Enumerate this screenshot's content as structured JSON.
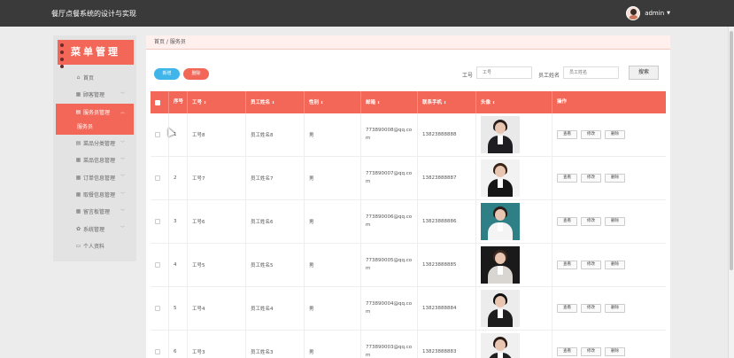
{
  "app": {
    "title": "餐厅点餐系统的设计与实现",
    "user": "admin"
  },
  "sidebar": {
    "logo": "菜单管理",
    "items": [
      {
        "label": "首页",
        "icon": "home-icon",
        "glyph": "⌂",
        "expandable": false
      },
      {
        "label": "顾客管理",
        "icon": "grid-icon",
        "glyph": "▦",
        "expandable": true
      },
      {
        "label": "服务员管理",
        "icon": "briefcase-icon",
        "glyph": "▤",
        "expandable": true,
        "active": true,
        "sub": "服务员"
      },
      {
        "label": "菜品分类管理",
        "icon": "briefcase-icon",
        "glyph": "▤",
        "expandable": true
      },
      {
        "label": "菜品信息管理",
        "icon": "grid-icon",
        "glyph": "▦",
        "expandable": true
      },
      {
        "label": "订单信息管理",
        "icon": "grid-icon",
        "glyph": "▦",
        "expandable": true
      },
      {
        "label": "取餐信息管理",
        "icon": "grid-icon",
        "glyph": "▦",
        "expandable": true
      },
      {
        "label": "留言板管理",
        "icon": "grid-icon",
        "glyph": "▦",
        "expandable": true
      },
      {
        "label": "系统管理",
        "icon": "gear-icon",
        "glyph": "✿",
        "expandable": true
      },
      {
        "label": "个人资料",
        "icon": "calendar-icon",
        "glyph": "▭",
        "expandable": false
      }
    ]
  },
  "main": {
    "breadcrumb": "首页 / 服务员",
    "add_label": "新增",
    "delete_label": "删除",
    "search": {
      "job_label": "工号",
      "job_placeholder": "工号",
      "name_label": "员工姓名",
      "name_placeholder": "员工姓名",
      "button_label": "搜索"
    },
    "table": {
      "headers": [
        "序号",
        "工号",
        "员工姓名",
        "性别",
        "邮箱",
        "联系手机",
        "头像",
        "操作"
      ],
      "rows": [
        {
          "no": "1",
          "job": "工号8",
          "name": "员工姓名8",
          "gender": "男",
          "email": "773890008@qq.com",
          "phone": "13823888888",
          "photo": {
            "bg": "#e9e9e9",
            "hair": "#2a1f1c",
            "body": "#1e1e22"
          }
        },
        {
          "no": "2",
          "job": "工号7",
          "name": "员工姓名7",
          "gender": "男",
          "email": "773890007@qq.com",
          "phone": "13823888887",
          "photo": {
            "bg": "#f2f2f2",
            "hair": "#3a2418",
            "body": "#161616"
          }
        },
        {
          "no": "3",
          "job": "工号6",
          "name": "员工姓名6",
          "gender": "男",
          "email": "773890006@qq.com",
          "phone": "13823888886",
          "photo": {
            "bg": "#2f7f86",
            "hair": "#2b1c18",
            "body": "#f4f4f4"
          }
        },
        {
          "no": "4",
          "job": "工号5",
          "name": "员工姓名5",
          "gender": "男",
          "email": "773890005@qq.com",
          "phone": "13823888885",
          "photo": {
            "bg": "#1a1a1a",
            "hair": "#3b2820",
            "body": "#d9d6d2"
          }
        },
        {
          "no": "5",
          "job": "工号4",
          "name": "员工姓名4",
          "gender": "男",
          "email": "773890004@qq.com",
          "phone": "13823888884",
          "photo": {
            "bg": "#ececec",
            "hair": "#111111",
            "body": "#1d1d1d"
          }
        },
        {
          "no": "6",
          "job": "工号3",
          "name": "员工姓名3",
          "gender": "男",
          "email": "773890003@qq.com",
          "phone": "13823888883",
          "photo": {
            "bg": "#f0f0f0",
            "hair": "#2a1a14",
            "body": "#202020"
          }
        }
      ],
      "ops": [
        "查看",
        "修改",
        "删除"
      ]
    }
  }
}
